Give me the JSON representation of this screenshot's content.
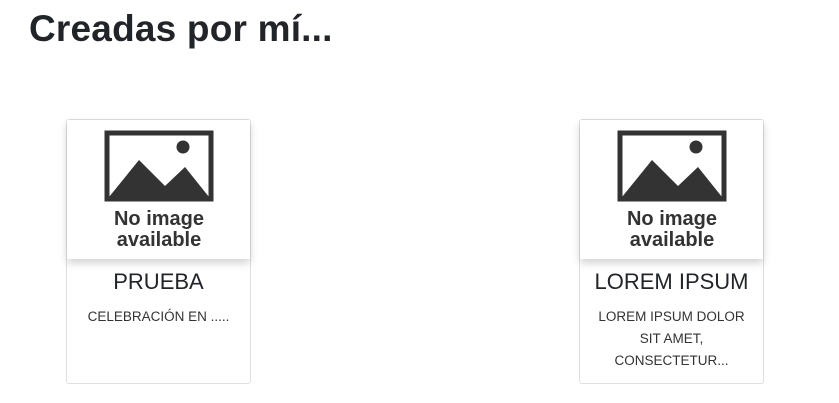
{
  "section": {
    "title": "Creadas por mí..."
  },
  "cards": [
    {
      "image_text_line1": "No image",
      "image_text_line2": "available",
      "title": "PRUEBA",
      "description": "CELEBRACIÓN EN ....."
    },
    {
      "image_text_line1": "No image",
      "image_text_line2": "available",
      "title": "LOREM IPSUM",
      "description": "LOREM IPSUM DOLOR SIT AMET, CONSECTETUR..."
    }
  ],
  "colors": {
    "text": "#212529",
    "placeholder_icon": "#333333",
    "card_border": "#dfdfdf"
  }
}
